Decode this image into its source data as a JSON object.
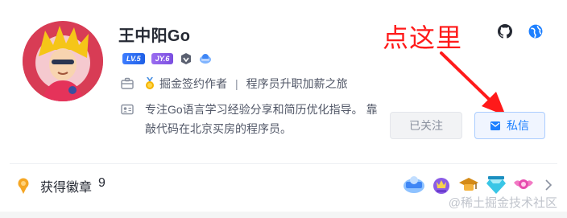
{
  "profile": {
    "name": "王中阳Go",
    "level_badge": "LV.5",
    "jy_badge": "JY.6",
    "job_signed": "掘金签约作者",
    "job_title": "程序员升职加薪之旅",
    "bio": "专注Go语言学习经验分享和简历优化指导。 靠敲代码在北京买房的程序员。"
  },
  "actions": {
    "followed_label": "已关注",
    "message_label": "私信"
  },
  "annotation": {
    "text": "点这里",
    "color": "#ff1a1a"
  },
  "badges": {
    "label": "获得徽章",
    "count": "9"
  },
  "watermark": "@稀土掘金技术社区",
  "colors": {
    "accent": "#1e80ff",
    "annotation_red": "#ff1a1a",
    "badge_orange": "#f5a623"
  }
}
